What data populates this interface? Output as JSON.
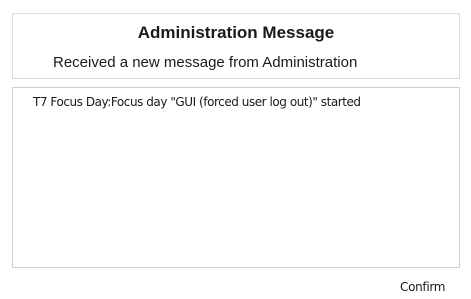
{
  "dialog": {
    "title": "Administration Message",
    "subtitle": "Received a new message from Administration",
    "messages": [
      "T7 Focus Day:Focus day \"GUI (forced user log out)\" started"
    ],
    "confirm_label": "Confirm"
  }
}
